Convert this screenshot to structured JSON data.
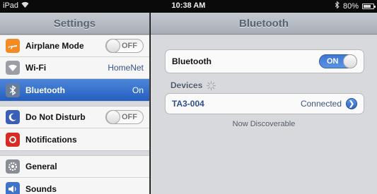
{
  "statusbar": {
    "device": "iPad",
    "time": "10:38 AM",
    "battery": "80%",
    "battery_level": 0.8
  },
  "settings": {
    "title": "Settings",
    "items": [
      {
        "label": "Airplane Mode",
        "value": "OFF",
        "icon": "airplane-icon",
        "icon_color": "#f38b24",
        "type": "toggle"
      },
      {
        "label": "Wi-Fi",
        "value": "HomeNet",
        "icon": "wifi-icon",
        "icon_color": "#9b9fa5",
        "type": "value"
      },
      {
        "label": "Bluetooth",
        "value": "On",
        "icon": "bluetooth-icon",
        "icon_color": "#6b7e99",
        "type": "value",
        "selected": true
      },
      {
        "label": "Do Not Disturb",
        "value": "OFF",
        "icon": "moon-icon",
        "icon_color": "#3a5fb5",
        "type": "toggle"
      },
      {
        "label": "Notifications",
        "value": "",
        "icon": "notifications-icon",
        "icon_color": "#d92b25",
        "type": "plain"
      },
      {
        "label": "General",
        "value": "",
        "icon": "gear-icon",
        "icon_color": "#8a8e94",
        "type": "plain"
      },
      {
        "label": "Sounds",
        "value": "",
        "icon": "speaker-icon",
        "icon_color": "#3e73c7",
        "type": "plain"
      }
    ]
  },
  "bluetooth": {
    "title": "Bluetooth",
    "toggle_label": "Bluetooth",
    "toggle_value": "ON",
    "devices_header": "Devices",
    "device": {
      "name": "TA3-004",
      "status": "Connected"
    },
    "discoverable_text": "Now Discoverable"
  },
  "colors": {
    "selected": "#245fc0",
    "toggle_on": "#3f77d1"
  }
}
